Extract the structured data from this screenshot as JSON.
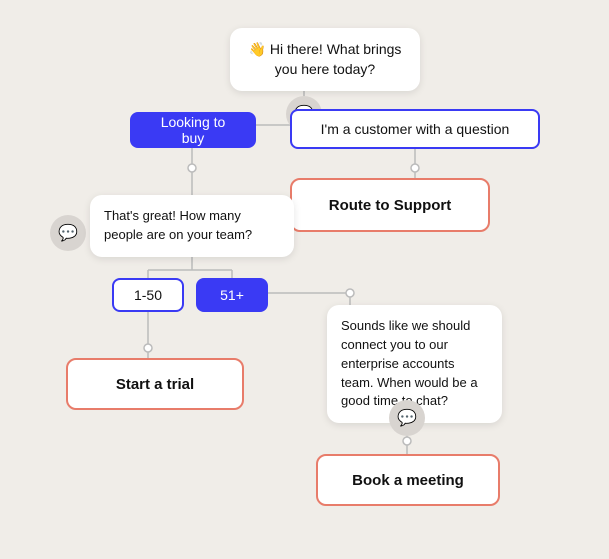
{
  "nodes": {
    "greeting": {
      "text": "👋 Hi there! What brings you here today?",
      "label": "greeting-bubble"
    },
    "icon_top": {
      "icon": "💬",
      "label": "icon-top"
    },
    "looking_to_buy": {
      "text": "Looking to buy",
      "label": "looking-to-buy-button"
    },
    "customer_question": {
      "text": "I'm a customer with a question",
      "label": "customer-question-button"
    },
    "team_size_bubble": {
      "text": "That's great! How many people are on your team?",
      "label": "team-size-bubble"
    },
    "icon_left": {
      "icon": "💬",
      "label": "icon-left"
    },
    "range_1_50": {
      "text": "1-50",
      "label": "range-1-50-button"
    },
    "range_51plus": {
      "text": "51+",
      "label": "range-51plus-button"
    },
    "route_to_support": {
      "text": "Route to Support",
      "label": "route-to-support-action"
    },
    "start_trial": {
      "text": "Start a trial",
      "label": "start-trial-action"
    },
    "enterprise_bubble": {
      "text": "Sounds like we should connect you to our enterprise accounts team. When would be a good time to chat?",
      "label": "enterprise-bubble"
    },
    "icon_bottom": {
      "icon": "💬",
      "label": "icon-bottom"
    },
    "book_meeting": {
      "text": "Book a meeting",
      "label": "book-meeting-action"
    }
  }
}
